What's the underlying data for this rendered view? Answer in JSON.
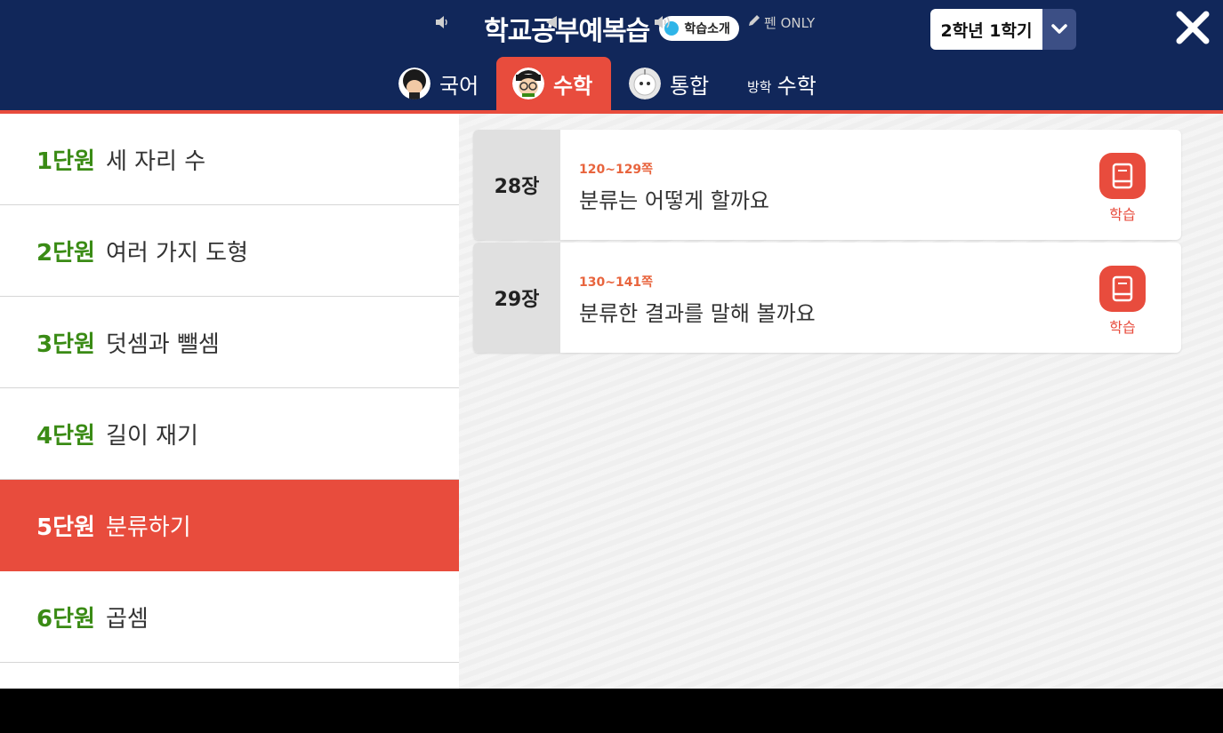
{
  "header": {
    "title": "학교공부예복습",
    "intro_label": "학습소개",
    "semester": "2학년 1학기"
  },
  "tabs": [
    {
      "label": "국어"
    },
    {
      "label": "수학"
    },
    {
      "label": "통합"
    },
    {
      "prefix": "방학",
      "label": "수학"
    }
  ],
  "units": [
    {
      "num": "1단원",
      "name": "세 자리 수"
    },
    {
      "num": "2단원",
      "name": "여러 가지 도형"
    },
    {
      "num": "3단원",
      "name": "덧셈과 뺄셈"
    },
    {
      "num": "4단원",
      "name": "길이 재기"
    },
    {
      "num": "5단원",
      "name": "분류하기"
    },
    {
      "num": "6단원",
      "name": "곱셈"
    }
  ],
  "lessons": [
    {
      "chapter": "28장",
      "pages": "120~129쪽",
      "title": "분류는 어떻게 할까요",
      "action": "학습"
    },
    {
      "chapter": "29장",
      "pages": "130~141쪽",
      "title": "분류한 결과를 말해 볼까요",
      "action": "학습"
    }
  ],
  "navbar": {
    "pen_label": "펜 ONLY"
  },
  "colors": {
    "header_bg": "#11275a",
    "accent": "#e84c3d",
    "unit_number": "#3a8b15",
    "pages_text": "#e8643d"
  }
}
